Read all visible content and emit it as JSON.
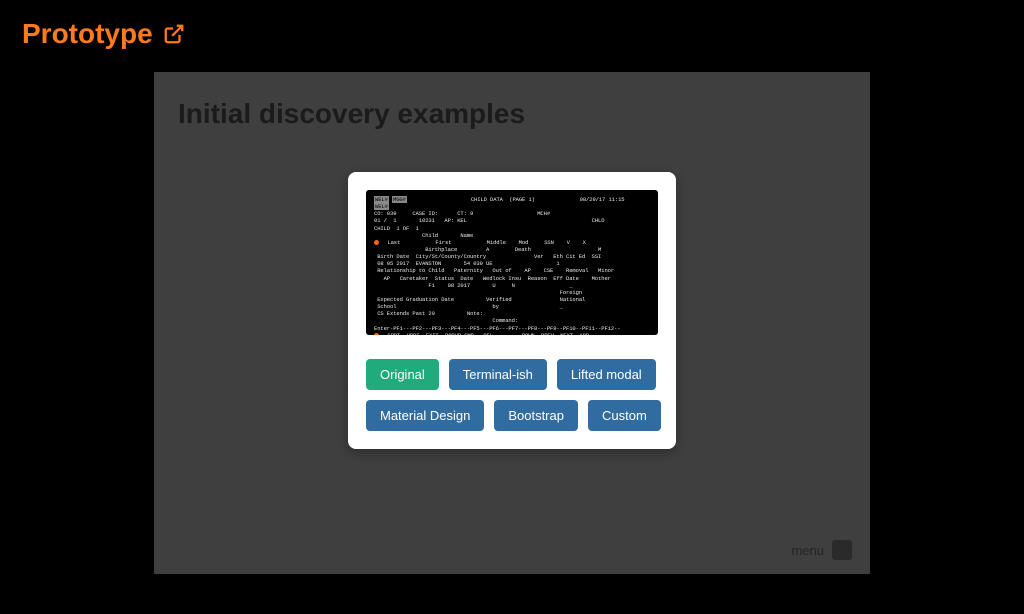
{
  "header": {
    "link_text": "Prototype"
  },
  "slide": {
    "title": "Initial discovery examples",
    "footer_menu_label": "menu"
  },
  "terminal": {
    "title_line": "                    CHILD DATA  (PAGE 1)              08/29/17 11:15",
    "line2_a": "WEL#",
    "line2_b": "MGG#",
    "line3": "CO: 039     CASE ID:      CT: 9                    MCH#",
    "line4": "01 /  1       10231   AP: KEL                                       CHLD",
    "line5": "CHILD  1 OF  1",
    "line6": "               Child       Name",
    "line7": "  Last           First           Middle    Mod     SSN    V    X",
    "line8": "                Birthplace         A        Death                     M",
    "line9": " Birth Date  City/St/County/Country               Ver   Eth Cit Ed  SSI",
    "line10": " 08 05 2017  EVANSTON       54 039 UE                    1",
    "line11": "",
    "line12": " Relationship to Child   Paternity   Out of    AP    CSE    Removal   Minor",
    "line13": "   AP   Caretaker  Status  Date   Wedlock Insu  Reason  Eff Date    Mother",
    "line14": "                 F1    08 2017       U     N                 _",
    "line15": "                                                          Foreign",
    "line16": " Expected Graduation Date          Verified               National",
    "line17": " School                              by                   _",
    "line18": "",
    "line19": " CS Extends Past 20          Note:",
    "line20": "                                     Command:",
    "line21": "Enter-PF1---PF2---PF3---PF4---PF5---PF6---PF7---PF8---PF9--PF10--PF11--PF12--",
    "line22": "  CRDT  UPDT  EXIT  POPUP CMD   DEL         DOWN  PREV  NEXT  ADD"
  },
  "buttons": {
    "row1": [
      {
        "label": "Original",
        "style": "green"
      },
      {
        "label": "Terminal-ish",
        "style": "blue"
      },
      {
        "label": "Lifted modal",
        "style": "blue"
      }
    ],
    "row2": [
      {
        "label": "Material Design",
        "style": "blue"
      },
      {
        "label": "Bootstrap",
        "style": "blue"
      },
      {
        "label": "Custom",
        "style": "blue"
      }
    ]
  }
}
